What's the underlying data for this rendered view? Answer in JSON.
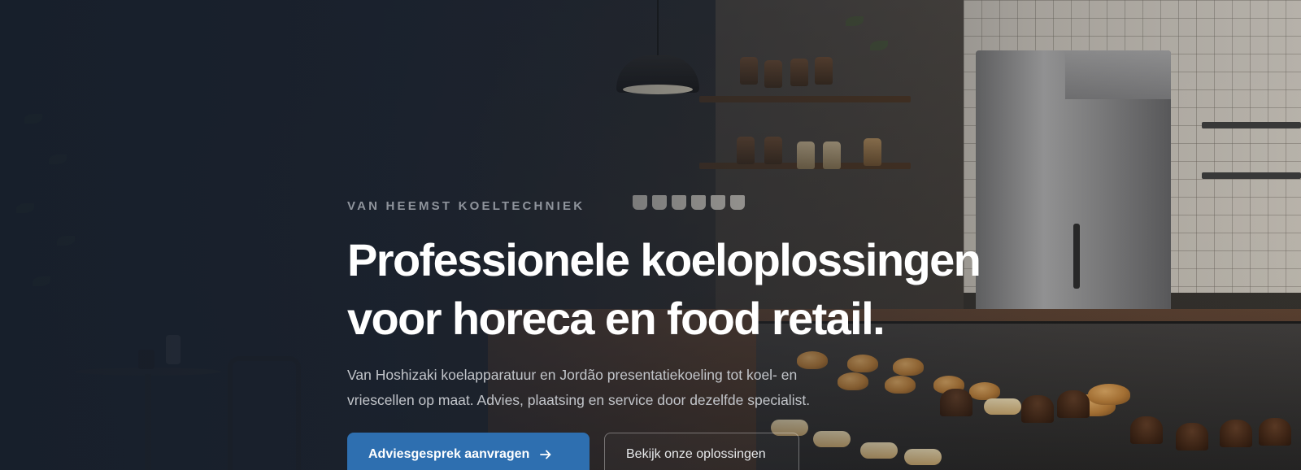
{
  "hero": {
    "eyebrow": "VAN HEEMST KOELTECHNIEK",
    "headline_line1": "Professionele koeloplossingen",
    "headline_line2": "voor horeca en food retail.",
    "lede_line1": "Van Hoshizaki koelapparatuur en Jordão presentatiekoeling tot koel- en",
    "lede_line2": "vriescellen op maat. Advies, plaatsing en service door dezelfde specialist.",
    "primary_cta": {
      "label": "Adviesgesprek aanvragen",
      "icon": "arrow-right-icon"
    },
    "secondary_cta": {
      "label": "Bekijk onze oplossingen"
    }
  },
  "colors": {
    "primary": "#2e6fb0",
    "text_light": "#ffffff",
    "eyebrow": "#8f949c",
    "overlay": "#1c2430"
  }
}
